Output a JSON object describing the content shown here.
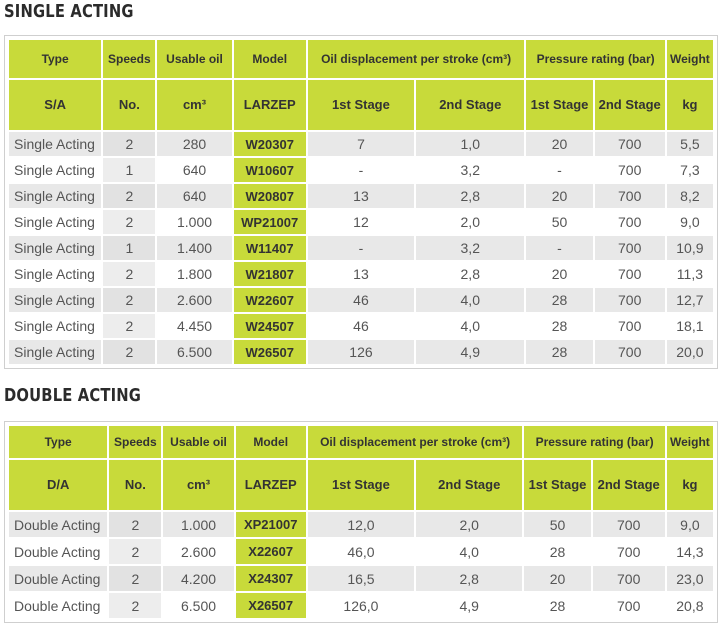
{
  "single": {
    "title": "SINGLE ACTING",
    "header1": [
      "Type",
      "Speeds",
      "Usable oil",
      "Model",
      "Oil displacement per stroke (cm³)",
      "Pressure rating (bar)",
      "Weight"
    ],
    "header2": [
      "S/A",
      "No.",
      "cm³",
      "LARZEP",
      "1st Stage",
      "2nd Stage",
      "1st Stage",
      "2nd Stage",
      "kg"
    ],
    "rows": [
      [
        "Single Acting",
        "2",
        "280",
        "W20307",
        "7",
        "1,0",
        "20",
        "700",
        "5,5"
      ],
      [
        "Single Acting",
        "1",
        "640",
        "W10607",
        "-",
        "3,2",
        "-",
        "700",
        "7,3"
      ],
      [
        "Single Acting",
        "2",
        "640",
        "W20807",
        "13",
        "2,8",
        "20",
        "700",
        "8,2"
      ],
      [
        "Single Acting",
        "2",
        "1.000",
        "WP21007",
        "12",
        "2,0",
        "50",
        "700",
        "9,0"
      ],
      [
        "Single Acting",
        "1",
        "1.400",
        "W11407",
        "-",
        "3,2",
        "-",
        "700",
        "10,9"
      ],
      [
        "Single Acting",
        "2",
        "1.800",
        "W21807",
        "13",
        "2,8",
        "20",
        "700",
        "11,3"
      ],
      [
        "Single Acting",
        "2",
        "2.600",
        "W22607",
        "46",
        "4,0",
        "28",
        "700",
        "12,7"
      ],
      [
        "Single Acting",
        "2",
        "4.450",
        "W24507",
        "46",
        "4,0",
        "28",
        "700",
        "18,1"
      ],
      [
        "Single Acting",
        "2",
        "6.500",
        "W26507",
        "126",
        "4,9",
        "28",
        "700",
        "20,0"
      ]
    ]
  },
  "double": {
    "title": "DOUBLE ACTING",
    "header1": [
      "Type",
      "Speeds",
      "Usable oil",
      "Model",
      "Oil displacement per stroke (cm³)",
      "Pressure rating (bar)",
      "Weight"
    ],
    "header2": [
      "D/A",
      "No.",
      "cm³",
      "LARZEP",
      "1st Stage",
      "2nd Stage",
      "1st Stage",
      "2nd Stage",
      "kg"
    ],
    "rows": [
      [
        "Double Acting",
        "2",
        "1.000",
        "XP21007",
        "12,0",
        "2,0",
        "50",
        "700",
        "9,0"
      ],
      [
        "Double Acting",
        "2",
        "2.600",
        "X22607",
        "46,0",
        "4,0",
        "28",
        "700",
        "14,3"
      ],
      [
        "Double Acting",
        "2",
        "4.200",
        "X24307",
        "16,5",
        "2,8",
        "20",
        "700",
        "23,0"
      ],
      [
        "Double Acting",
        "2",
        "6.500",
        "X26507",
        "126,0",
        "4,9",
        "28",
        "700",
        "20,8"
      ]
    ]
  }
}
